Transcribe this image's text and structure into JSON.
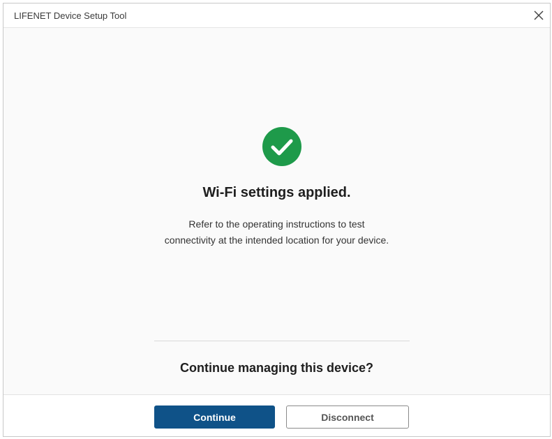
{
  "window": {
    "title": "LIFENET Device Setup Tool",
    "close_icon": "close-icon"
  },
  "status": {
    "icon": "check-circle-icon",
    "icon_color": "#1e9a4a",
    "heading": "Wi-Fi settings applied.",
    "description_line1": "Refer to the operating instructions to test",
    "description_line2": "connectivity at the intended location for your device."
  },
  "prompt": {
    "question": "Continue managing this device?"
  },
  "actions": {
    "continue_label": "Continue",
    "disconnect_label": "Disconnect",
    "primary_color": "#0f5288"
  }
}
